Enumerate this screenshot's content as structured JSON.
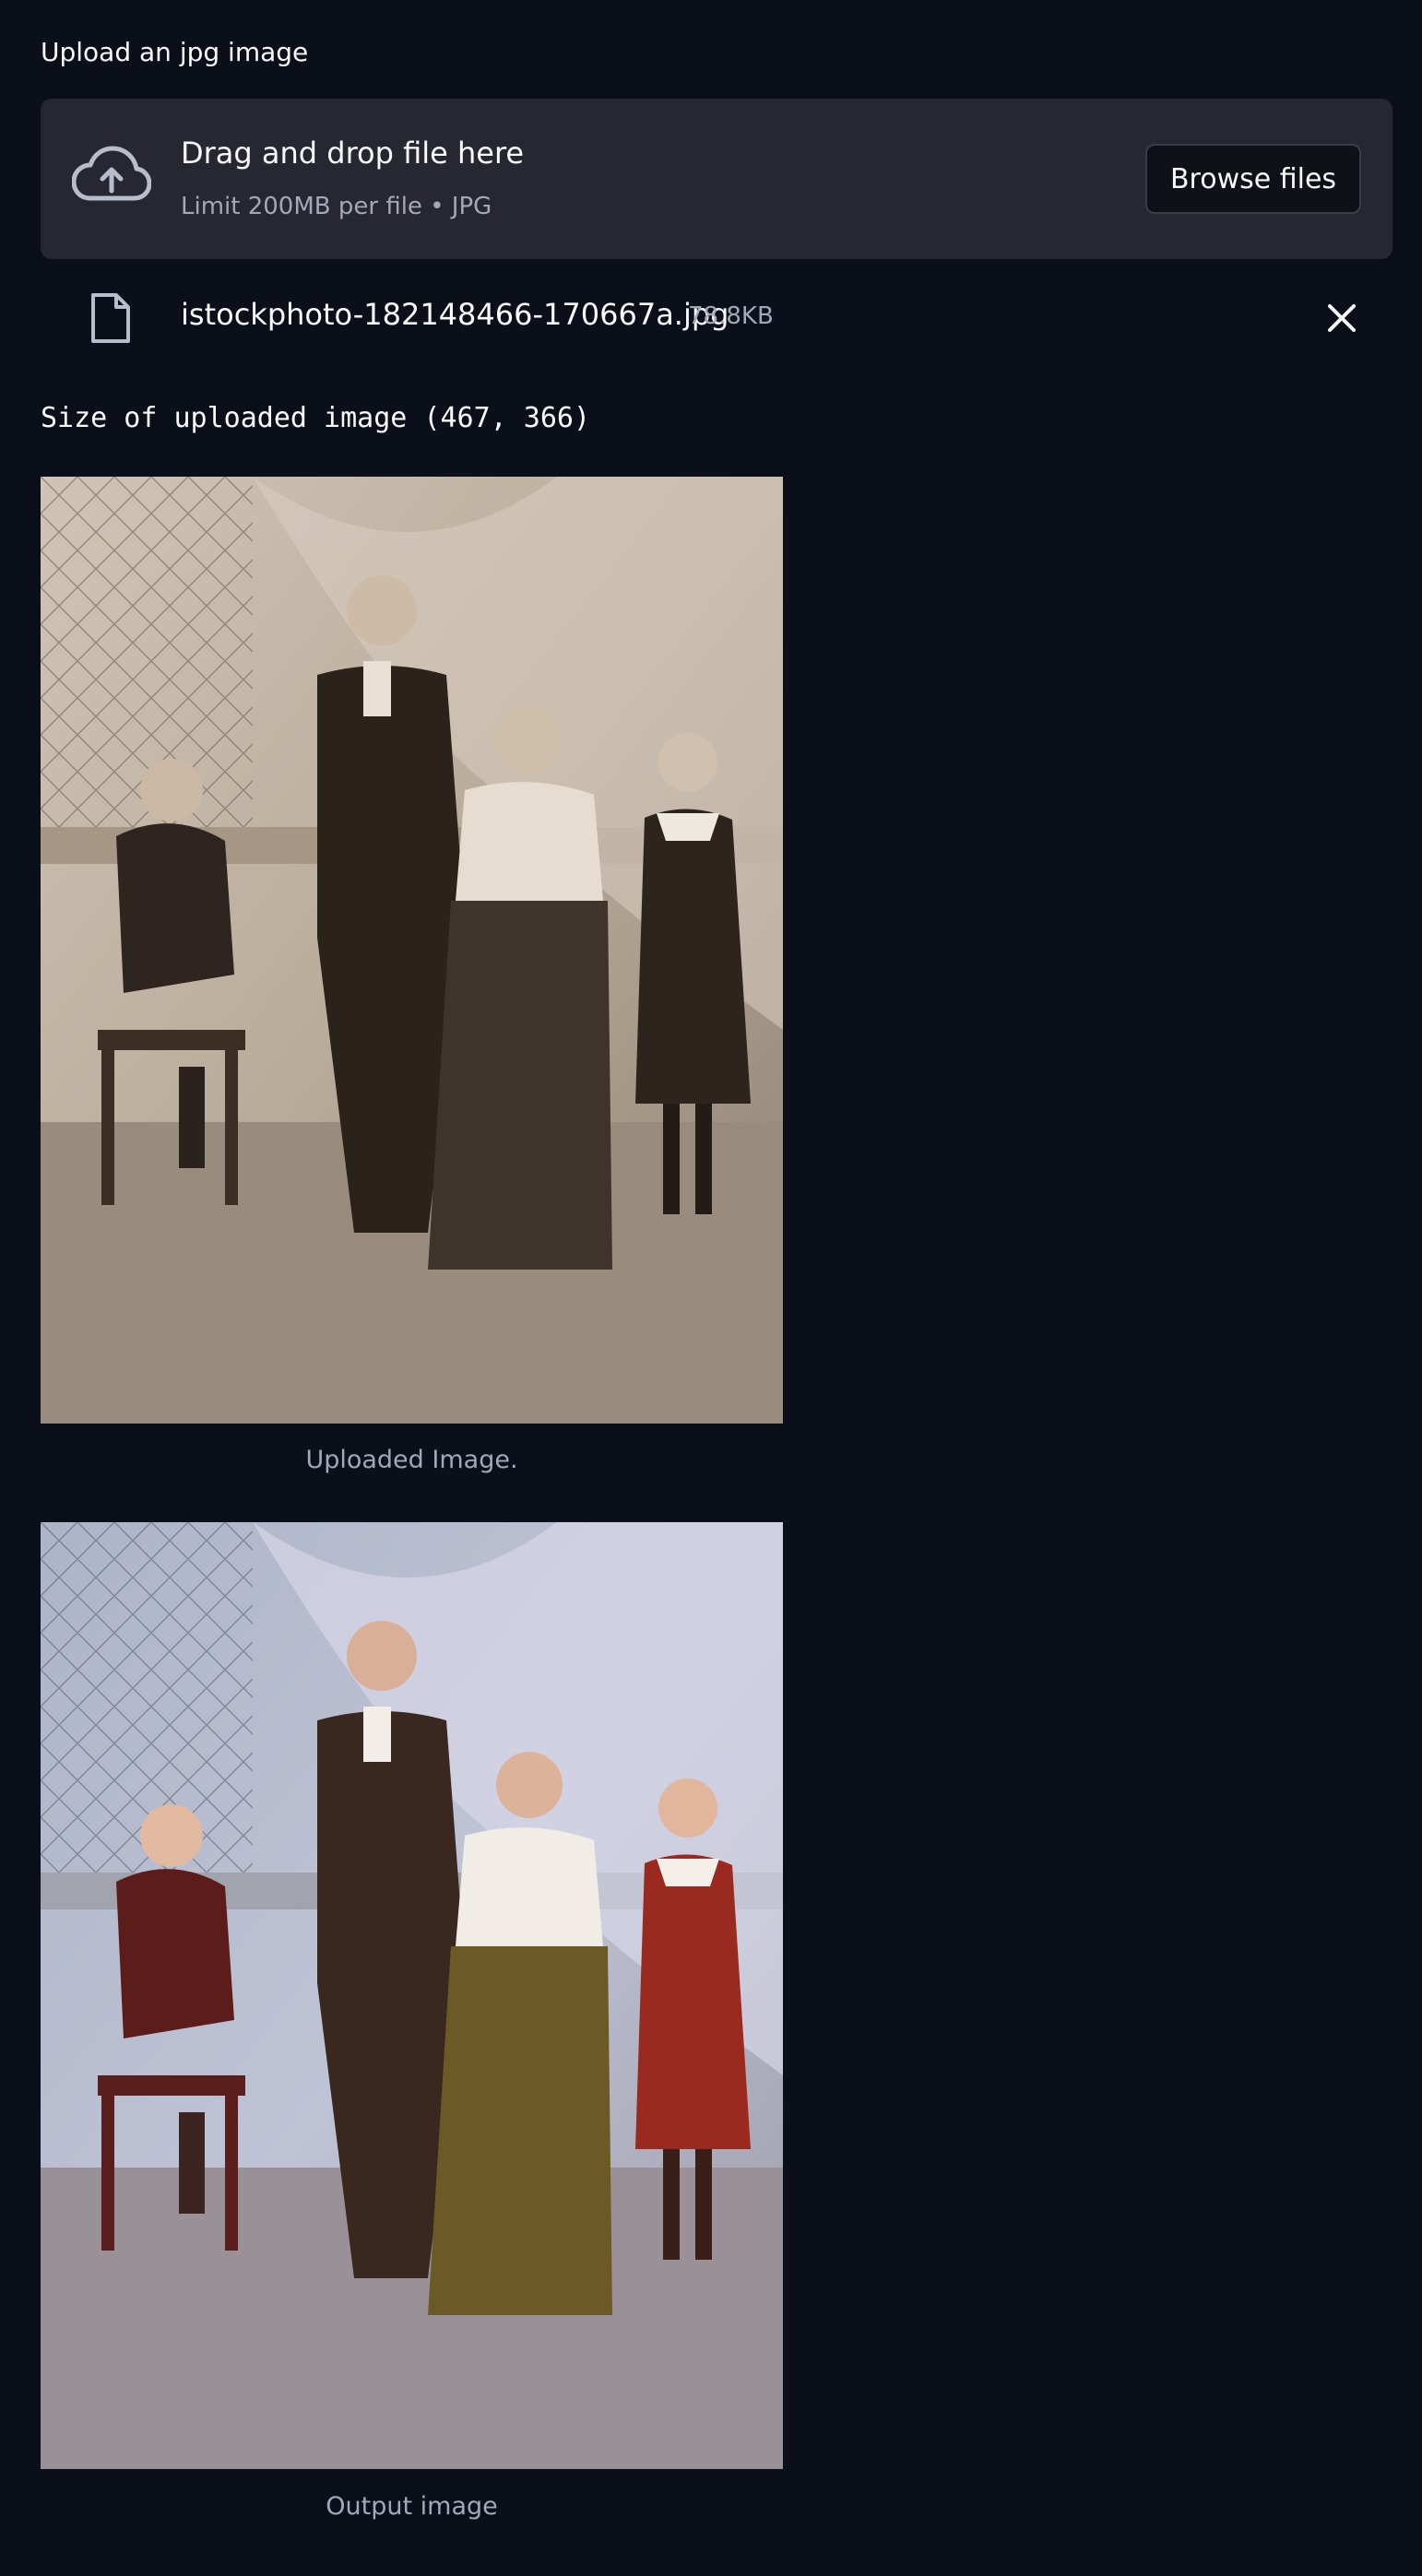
{
  "uploader": {
    "label": "Upload an jpg image",
    "dropzone_title": "Drag and drop file here",
    "dropzone_subtitle": "Limit 200MB per file • JPG",
    "browse_label": "Browse files"
  },
  "uploaded_file": {
    "name": "istockphoto-182148466-170667a.jpg",
    "size": "78.8KB"
  },
  "size_text": "Size of uploaded image (467, 366)",
  "images": [
    {
      "caption": "Uploaded Image.",
      "style": "sepia"
    },
    {
      "caption": "Output image",
      "style": "colorized"
    }
  ],
  "colors": {
    "background": "#0b0f19",
    "dropzone": "#262730",
    "muted_text": "#a3a8b8",
    "icon": "#b8bdcc"
  },
  "icons": {
    "upload": "cloud-upload-icon",
    "file": "file-icon",
    "close": "close-icon"
  }
}
